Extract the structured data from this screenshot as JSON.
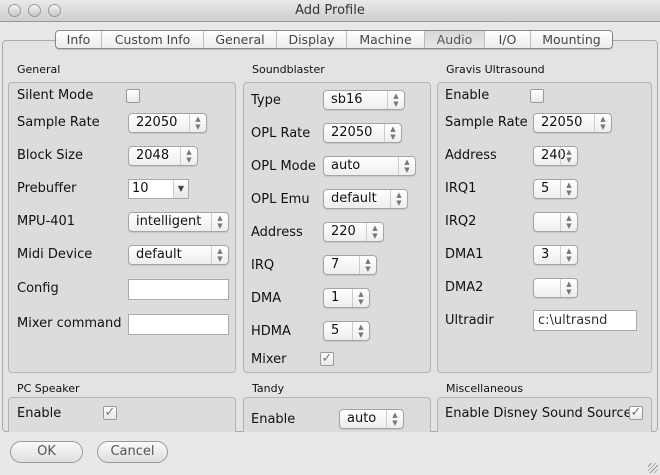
{
  "window": {
    "title": "Add Profile"
  },
  "tabs": [
    "Info",
    "Custom Info",
    "General",
    "Display",
    "Machine",
    "Audio",
    "I/O",
    "Mounting"
  ],
  "active_tab": "Audio",
  "general": {
    "title": "General",
    "silent_mode": "Silent Mode",
    "sample_rate": "Sample Rate",
    "sample_rate_val": "22050",
    "block_size": "Block Size",
    "block_size_val": "2048",
    "prebuffer": "Prebuffer",
    "prebuffer_val": "10",
    "mpu": "MPU-401",
    "mpu_val": "intelligent",
    "midi": "Midi Device",
    "midi_val": "default",
    "config": "Config",
    "config_val": "",
    "mixer": "Mixer command",
    "mixer_val": ""
  },
  "sb": {
    "title": "Soundblaster",
    "type": "Type",
    "type_val": "sb16",
    "opl_rate": "OPL Rate",
    "opl_rate_val": "22050",
    "opl_mode": "OPL Mode",
    "opl_mode_val": "auto",
    "opl_emu": "OPL Emu",
    "opl_emu_val": "default",
    "address": "Address",
    "address_val": "220",
    "irq": "IRQ",
    "irq_val": "7",
    "dma": "DMA",
    "dma_val": "1",
    "hdma": "HDMA",
    "hdma_val": "5",
    "mixer": "Mixer"
  },
  "gus": {
    "title": "Gravis Ultrasound",
    "enable": "Enable",
    "sample_rate": "Sample Rate",
    "sample_rate_val": "22050",
    "address": "Address",
    "address_val": "240",
    "irq1": "IRQ1",
    "irq1_val": "5",
    "irq2": "IRQ2",
    "irq2_val": "",
    "dma1": "DMA1",
    "dma1_val": "3",
    "dma2": "DMA2",
    "dma2_val": "",
    "ultradir": "Ultradir",
    "ultradir_val": "c:\\ultrasnd"
  },
  "pcspeaker": {
    "title": "PC Speaker",
    "enable": "Enable"
  },
  "tandy": {
    "title": "Tandy",
    "enable": "Enable",
    "enable_val": "auto"
  },
  "misc": {
    "title": "Miscellaneous",
    "disney": "Enable Disney Sound Source"
  },
  "buttons": {
    "ok": "OK",
    "cancel": "Cancel"
  },
  "glyphs": {
    "check": "✓",
    "updown": "▲▼",
    "down": "▼"
  }
}
